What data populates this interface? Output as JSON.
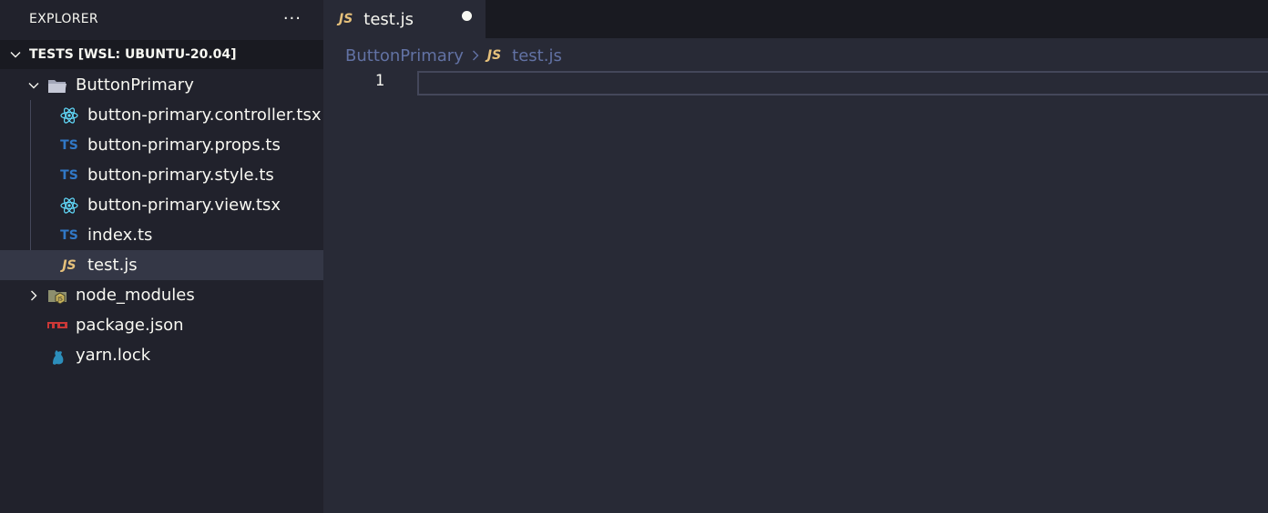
{
  "sidebar": {
    "title": "EXPLORER",
    "more_label": "···",
    "workspace": "TESTS [WSL: UBUNTU-20.04]",
    "tree": {
      "folder": "ButtonPrimary",
      "files": [
        {
          "name": "button-primary.controller.tsx",
          "icon": "react-icon"
        },
        {
          "name": "button-primary.props.ts",
          "icon": "ts-icon",
          "badge": "TS"
        },
        {
          "name": "button-primary.style.ts",
          "icon": "ts-icon",
          "badge": "TS"
        },
        {
          "name": "button-primary.view.tsx",
          "icon": "react-icon"
        },
        {
          "name": "index.ts",
          "icon": "ts-icon",
          "badge": "TS"
        },
        {
          "name": "test.js",
          "icon": "js-icon",
          "badge": "JS",
          "selected": true
        }
      ],
      "node_modules": "node_modules",
      "package_json": "package.json",
      "yarn_lock": "yarn.lock"
    }
  },
  "editor": {
    "tab": {
      "badge": "JS",
      "label": "test.js",
      "dirty": true
    },
    "breadcrumb": {
      "folder": "ButtonPrimary",
      "badge": "JS",
      "file": "test.js"
    },
    "line_number": "1"
  },
  "colors": {
    "sidebar_bg": "#21222c",
    "editor_bg": "#282a36",
    "ts": "#3178c6",
    "js": "#e5c07b",
    "react": "#61dafb",
    "npm": "#cb3837",
    "yarn": "#2c8ebb"
  }
}
